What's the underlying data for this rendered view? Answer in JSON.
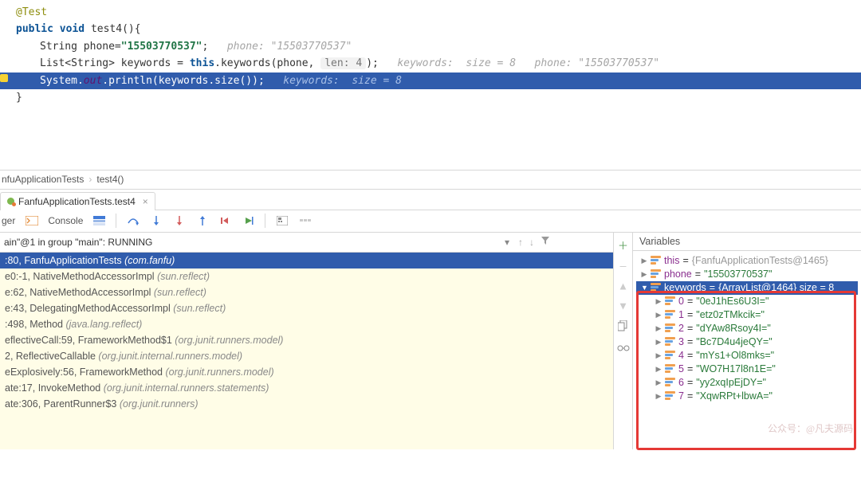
{
  "code": {
    "annot": "@Test",
    "kw_public": "public",
    "kw_void": "void",
    "method": "test4",
    "sig_rest": "(){",
    "line3_a": "String phone=",
    "line3_str": "\"15503770537\"",
    "line3_semi": ";",
    "line3_cm": "phone: \"15503770537\"",
    "line4_a": "List<String> keywords = ",
    "line4_this": "this",
    "line4_b": ".keywords(phone, ",
    "line4_pill": "len: 4",
    "line4_c": ");",
    "line4_cm": "keywords:  size = 8   phone: \"15503770537\"",
    "line5_a": "System.",
    "line5_out": "out",
    "line5_b": ".println(keywords.size());",
    "line5_cm": "keywords:  size = 8",
    "close_brace": "}"
  },
  "crumbs": {
    "a": "nfuApplicationTests",
    "b": "test4()"
  },
  "dbg_tab": {
    "label": "FanfuApplicationTests.test4"
  },
  "toolbar": {
    "partial": "ger",
    "console": "Console"
  },
  "thread": {
    "label": "ain\"@1 in group \"main\": RUNNING"
  },
  "frames": [
    {
      "main": ":80, FanfuApplicationTests ",
      "pkg": "(com.fanfu)",
      "sel": true
    },
    {
      "main": "e0:-1, NativeMethodAccessorImpl ",
      "pkg": "(sun.reflect)"
    },
    {
      "main": "e:62, NativeMethodAccessorImpl ",
      "pkg": "(sun.reflect)"
    },
    {
      "main": "e:43, DelegatingMethodAccessorImpl ",
      "pkg": "(sun.reflect)"
    },
    {
      "main": ":498, Method ",
      "pkg": "(java.lang.reflect)"
    },
    {
      "main": "eflectiveCall:59, FrameworkMethod$1 ",
      "pkg": "(org.junit.runners.model)"
    },
    {
      "main": "2, ReflectiveCallable ",
      "pkg": "(org.junit.internal.runners.model)"
    },
    {
      "main": "eExplosively:56, FrameworkMethod ",
      "pkg": "(org.junit.runners.model)"
    },
    {
      "main": "ate:17, InvokeMethod ",
      "pkg": "(org.junit.internal.runners.statements)"
    },
    {
      "main": "ate:306, ParentRunner$3 ",
      "pkg": "(org.junit.runners)"
    }
  ],
  "vars": {
    "title": "Variables",
    "this_name": "this",
    "this_val": "{FanfuApplicationTests@1465}",
    "phone_name": "phone",
    "phone_val": "\"15503770537\"",
    "kw_name": "keywords",
    "kw_val": "{ArrayList@1464}  size = 8",
    "items": [
      {
        "idx": "0",
        "val": "\"0eJ1hEs6U3I=\""
      },
      {
        "idx": "1",
        "val": "\"etz0zTMkcik=\""
      },
      {
        "idx": "2",
        "val": "\"dYAw8Rsoy4I=\""
      },
      {
        "idx": "3",
        "val": "\"Bc7D4u4jeQY=\""
      },
      {
        "idx": "4",
        "val": "\"mYs1+Ol8mks=\""
      },
      {
        "idx": "5",
        "val": "\"WO7H17l8n1E=\""
      },
      {
        "idx": "6",
        "val": "\"yy2xqIpEjDY=\""
      },
      {
        "idx": "7",
        "val": "\"XqwRPt+lbwA=\""
      }
    ]
  },
  "watermark": "公众号：@凡夫源码"
}
